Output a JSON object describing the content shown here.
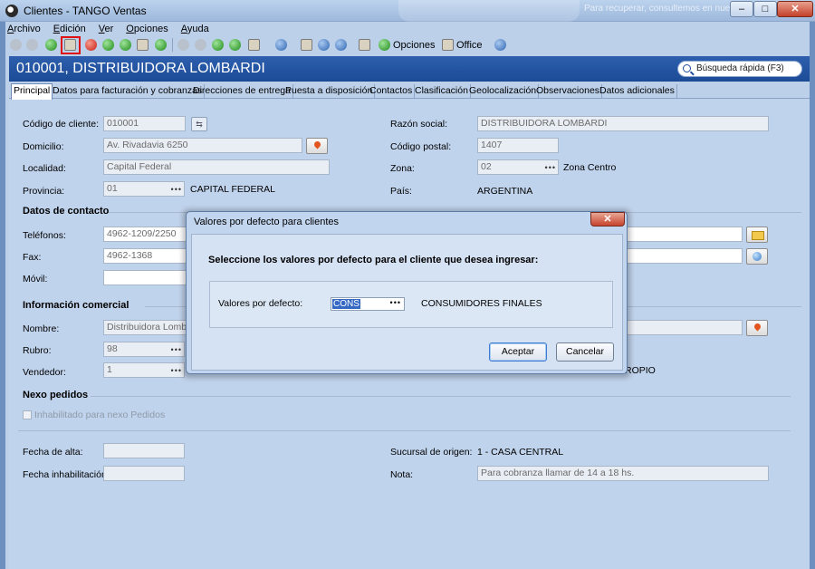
{
  "window": {
    "title": "Clientes - TANGO Ventas",
    "ghost_right": "Para recuperar, consultemos en nuestros"
  },
  "menu": [
    "Archivo",
    "Edición",
    "Ver",
    "Opciones",
    "Ayuda"
  ],
  "toolbar": {
    "opciones_label": "Opciones",
    "office_label": "Office"
  },
  "header": {
    "customer": "010001, DISTRIBUIDORA LOMBARDI",
    "search_label": "Búsqueda rápida (F3)"
  },
  "tabs": [
    "Principal",
    "Datos para facturación y cobranzas",
    "Direcciones de entrega",
    "Puesta a disposición",
    "Contactos",
    "Clasificación",
    "Geolocalización",
    "Observaciones",
    "Datos adicionales"
  ],
  "form": {
    "codigo_label": "Código de cliente:",
    "codigo_value": "010001",
    "domicilio_label": "Domicilio:",
    "domicilio_value": "Av. Rivadavia 6250",
    "localidad_label": "Localidad:",
    "localidad_value": "Capital Federal",
    "provincia_label": "Provincia:",
    "provincia_code": "01",
    "provincia_name": "CAPITAL FEDERAL",
    "razon_label": "Razón social:",
    "razon_value": "DISTRIBUIDORA LOMBARDI",
    "cp_label": "Código postal:",
    "cp_value": "1407",
    "zona_label": "Zona:",
    "zona_code": "02",
    "zona_name": "Zona Centro",
    "pais_label": "País:",
    "pais_value": "ARGENTINA",
    "contacto_section": "Datos de contacto",
    "telefonos_label": "Teléfonos:",
    "telefonos_value": "4962-1209/2250",
    "fax_label": "Fax:",
    "fax_value": "4962-1368",
    "movil_label": "Móvil:",
    "comercial_section": "Información comercial",
    "nombre_label": "Nombre:",
    "nombre_value": "Distribuidora Lombard",
    "rubro_label": "Rubro:",
    "rubro_value": "98",
    "vendedor_label": "Vendedor:",
    "vendedor_value": "1",
    "vendedor_tail": "ROPIO",
    "nexo_section": "Nexo pedidos",
    "nexo_check_label": "Inhabilitado para nexo Pedidos",
    "alta_label": "Fecha de alta:",
    "inhab_label": "Fecha inhabilitación:",
    "sucursal_label": "Sucursal de origen:",
    "sucursal_value": "1 - CASA CENTRAL",
    "nota_label": "Nota:",
    "nota_value": "Para cobranza llamar de 14 a 18 hs."
  },
  "dialog": {
    "title": "Valores por defecto para clientes",
    "prompt": "Seleccione los valores por defecto para el cliente que desea ingresar:",
    "field_label": "Valores por defecto:",
    "field_value": "CONS",
    "field_desc": "CONSUMIDORES FINALES",
    "ok_label": "Aceptar",
    "cancel_label": "Cancelar"
  }
}
